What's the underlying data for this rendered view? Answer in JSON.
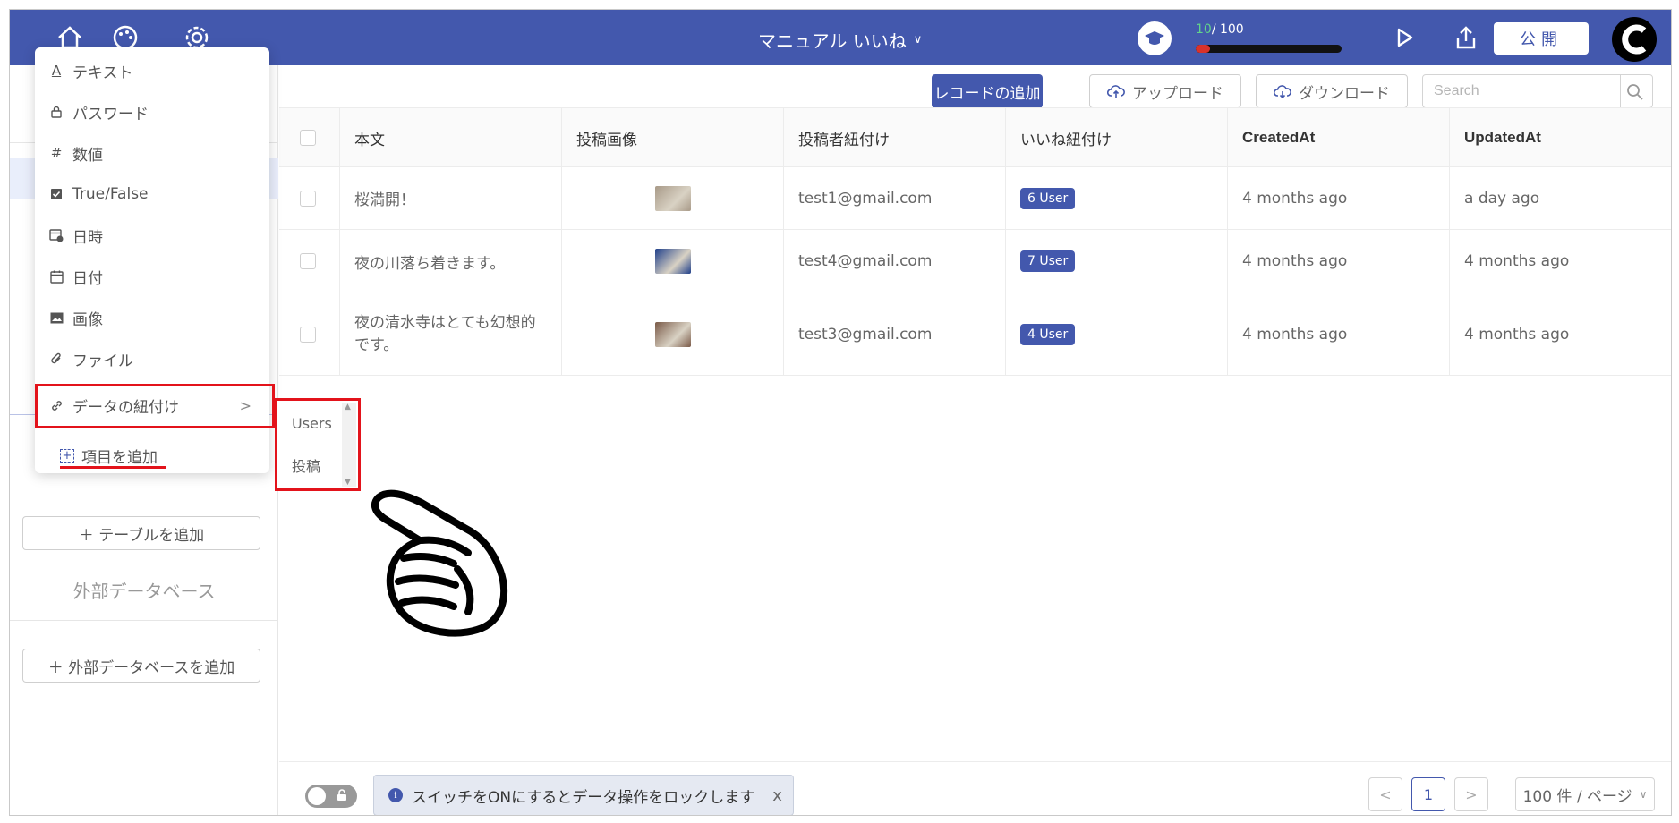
{
  "header": {
    "title": "マニュアル いいね",
    "progress": {
      "current": "10",
      "total": "/ 100",
      "fraction": 0.1
    },
    "publish_label": "公開"
  },
  "menu": {
    "items": [
      {
        "label": "テキスト",
        "icon": "text-icon"
      },
      {
        "label": "パスワード",
        "icon": "lock-icon"
      },
      {
        "label": "数値",
        "icon": "hash-icon"
      },
      {
        "label": "True/False",
        "icon": "checkbox-icon"
      },
      {
        "label": "日時",
        "icon": "calendar-clock-icon"
      },
      {
        "label": "日付",
        "icon": "calendar-icon"
      },
      {
        "label": "画像",
        "icon": "image-icon"
      },
      {
        "label": "ファイル",
        "icon": "paperclip-icon"
      }
    ],
    "relation_label": "データの紐付け",
    "add_item_label": "項目を追加",
    "submenu": [
      "Users",
      "投稿"
    ]
  },
  "sidebar": {
    "add_table_label": "＋ テーブルを追加",
    "external_db_label": "外部データベース",
    "add_external_db_label": "＋ 外部データベースを追加"
  },
  "toolbar": {
    "add_record_label": "レコードの追加",
    "upload_label": "アップロード",
    "download_label": "ダウンロード",
    "search_placeholder": "Search"
  },
  "table": {
    "columns": [
      "本文",
      "投稿画像",
      "投稿者紐付け",
      "いいね紐付け",
      "CreatedAt",
      "UpdatedAt"
    ],
    "rows": [
      {
        "body": "桜満開！",
        "author": "test1@gmail.com",
        "likes": "6 User",
        "created": "4 months ago",
        "updated": "a day ago",
        "thumb": "#a89a88"
      },
      {
        "body": "夜の川落ち着きます。",
        "author": "test4@gmail.com",
        "likes": "7 User",
        "created": "4 months ago",
        "updated": "4 months ago",
        "thumb": "#1f3f8a"
      },
      {
        "body": "夜の清水寺はとても幻想的です。",
        "author": "test3@gmail.com",
        "likes": "4 User",
        "created": "4 months ago",
        "updated": "4 months ago",
        "thumb": "#7a5a48"
      }
    ]
  },
  "footer": {
    "lock_note": "スイッチをONにするとデータ操作をロックします",
    "close": "x",
    "page_prev": "<",
    "page_current": "1",
    "page_next": ">",
    "per_page": "100 件 / ページ"
  },
  "colors": {
    "brand": "#4358ad",
    "highlight": "#e3131b"
  }
}
